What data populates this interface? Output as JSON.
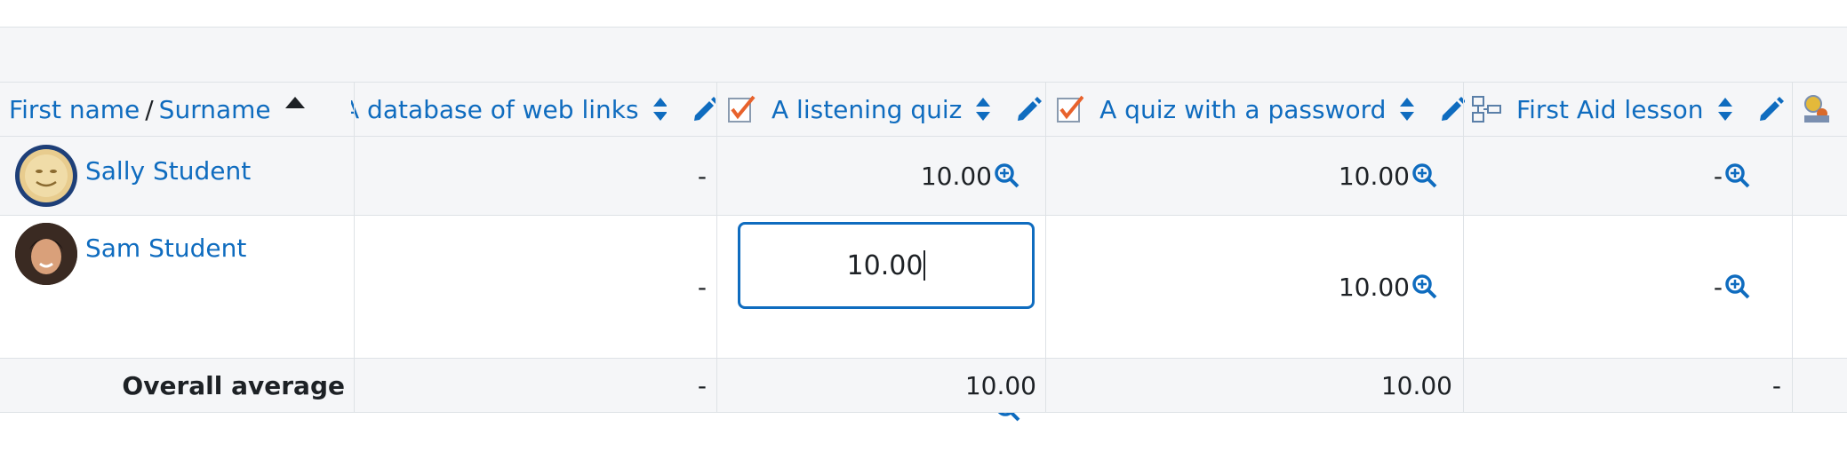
{
  "header": {
    "first_name": "First name",
    "separator": "/",
    "surname": "Surname",
    "columns": [
      {
        "label": "A database of web links",
        "icon": "database-icon"
      },
      {
        "label": "A listening quiz",
        "icon": "quiz-icon"
      },
      {
        "label": "A quiz with a password",
        "icon": "quiz-icon"
      },
      {
        "label": "First Aid lesson",
        "icon": "lesson-icon"
      }
    ]
  },
  "students": [
    {
      "name": "Sally Student",
      "grades": [
        "-",
        "10.00",
        "10.00",
        "-"
      ]
    },
    {
      "name": "Sam Student",
      "grades": [
        "-",
        "10.00",
        "10.00",
        "-"
      ],
      "editing_value": "10.00"
    }
  ],
  "overall": {
    "label": "Overall average",
    "values": [
      "-",
      "10.00",
      "10.00",
      "-"
    ]
  },
  "colors": {
    "link": "#0f6cbf",
    "quiz_check": "#e8622c",
    "border": "#dee2e6"
  }
}
